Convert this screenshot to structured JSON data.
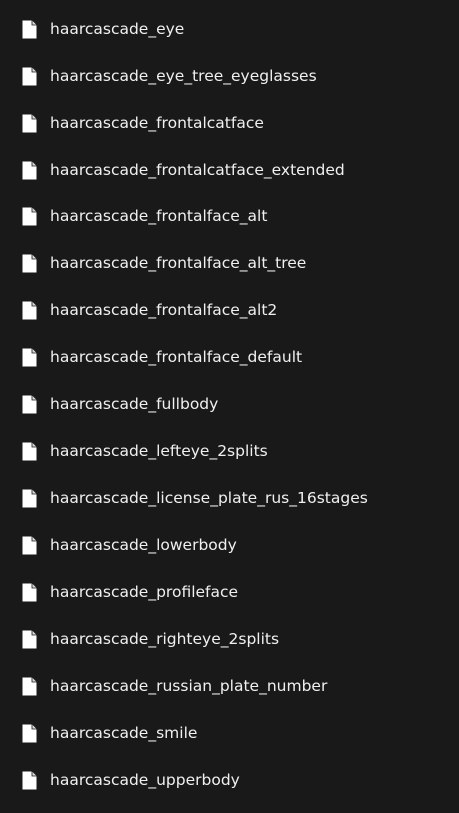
{
  "files": [
    {
      "name": "haarcascade_eye",
      "icon": "document-icon"
    },
    {
      "name": "haarcascade_eye_tree_eyeglasses",
      "icon": "document-icon"
    },
    {
      "name": "haarcascade_frontalcatface",
      "icon": "document-icon"
    },
    {
      "name": "haarcascade_frontalcatface_extended",
      "icon": "document-icon"
    },
    {
      "name": "haarcascade_frontalface_alt",
      "icon": "document-icon"
    },
    {
      "name": "haarcascade_frontalface_alt_tree",
      "icon": "document-icon"
    },
    {
      "name": "haarcascade_frontalface_alt2",
      "icon": "document-icon"
    },
    {
      "name": "haarcascade_frontalface_default",
      "icon": "document-icon"
    },
    {
      "name": "haarcascade_fullbody",
      "icon": "document-icon"
    },
    {
      "name": "haarcascade_lefteye_2splits",
      "icon": "document-icon"
    },
    {
      "name": "haarcascade_license_plate_rus_16stages",
      "icon": "document-icon"
    },
    {
      "name": "haarcascade_lowerbody",
      "icon": "document-icon"
    },
    {
      "name": "haarcascade_profileface",
      "icon": "document-icon"
    },
    {
      "name": "haarcascade_righteye_2splits",
      "icon": "document-icon"
    },
    {
      "name": "haarcascade_russian_plate_number",
      "icon": "document-icon"
    },
    {
      "name": "haarcascade_smile",
      "icon": "document-icon"
    },
    {
      "name": "haarcascade_upperbody",
      "icon": "document-icon"
    }
  ],
  "colors": {
    "background": "#191919",
    "text": "#f0f0f0",
    "icon_fill": "#ffffff"
  }
}
